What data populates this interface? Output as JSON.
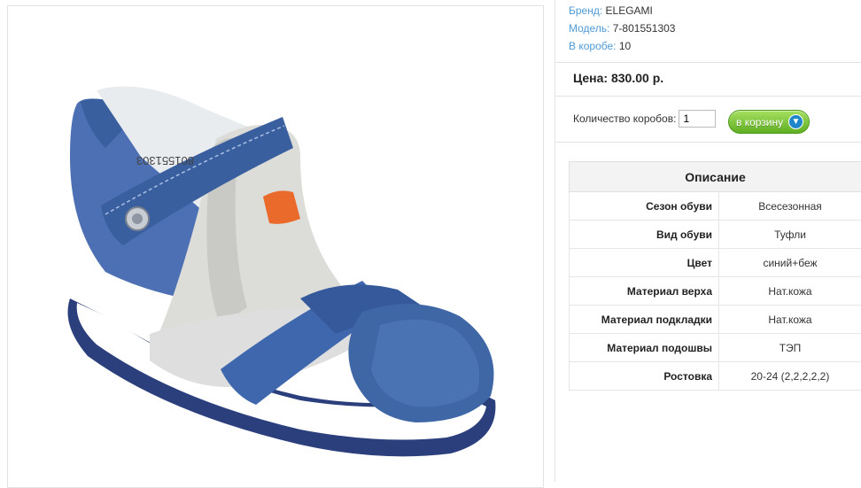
{
  "product_meta": {
    "brand_label": "Бренд:",
    "brand_value": "ELEGAMI",
    "model_label": "Модель:",
    "model_value": "7-801551303",
    "box_label": "В коробе:",
    "box_value": "10"
  },
  "price": {
    "text": "Цена: 830.00 р."
  },
  "order": {
    "qty_label": "Количество коробов:",
    "qty_value": "1",
    "cart_button": "в корзину"
  },
  "description": {
    "title": "Описание",
    "rows": [
      {
        "key": "Сезон обуви",
        "value": "Всесезонная"
      },
      {
        "key": "Вид обуви",
        "value": "Туфли"
      },
      {
        "key": "Цвет",
        "value": "синий+беж"
      },
      {
        "key": "Материал верха",
        "value": "Нат.кожа"
      },
      {
        "key": "Материал подкладки",
        "value": "Нат.кожа"
      },
      {
        "key": "Материал подошвы",
        "value": "ТЭП"
      },
      {
        "key": "Ростовка",
        "value": "20-24 (2,2,2,2,2)"
      }
    ]
  },
  "image": {
    "imprint_text": "801551303"
  },
  "colors": {
    "link": "#4f9ad6",
    "button_green": "#6abd2b",
    "sandal_blue": "#3e5f9c"
  }
}
